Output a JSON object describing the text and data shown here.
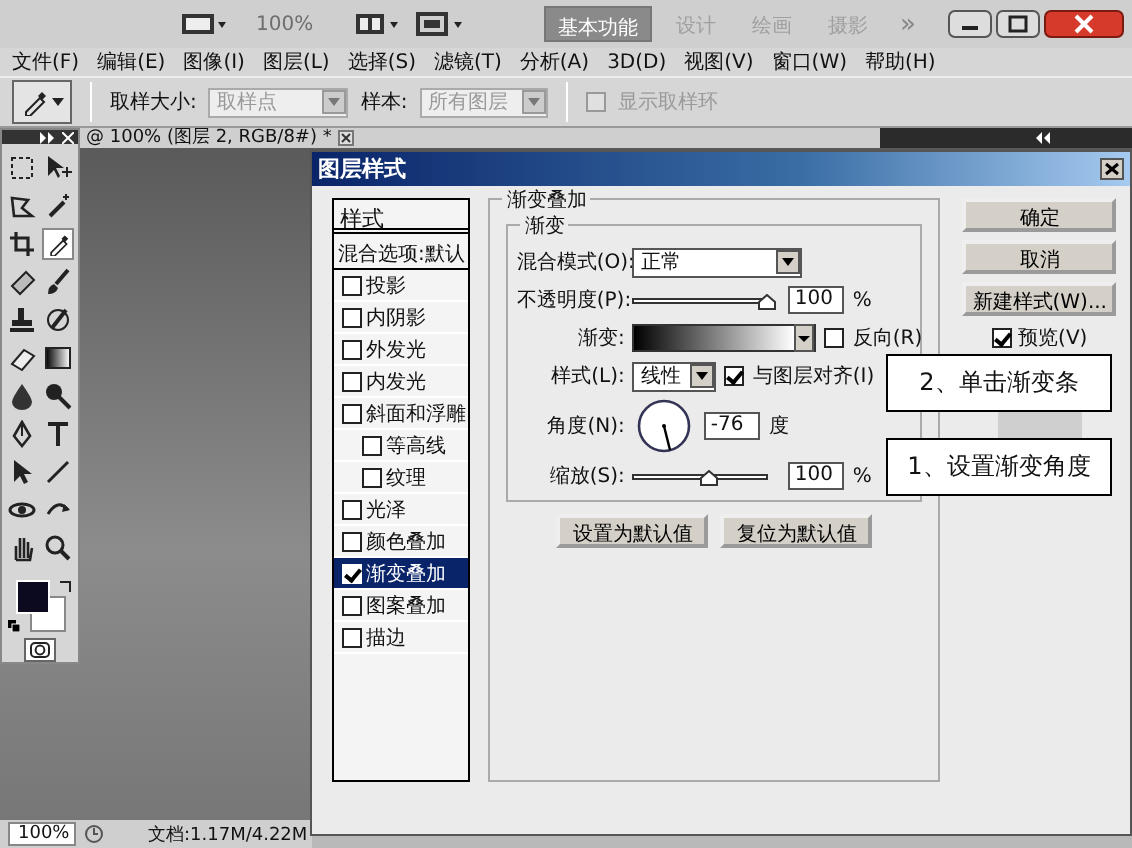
{
  "app_bar": {
    "zoom_value": "100%",
    "workspaces": [
      {
        "label": "基本功能",
        "selected": true
      },
      {
        "label": "设计",
        "selected": false
      },
      {
        "label": "绘画",
        "selected": false
      },
      {
        "label": "摄影",
        "selected": false
      }
    ],
    "more": "»"
  },
  "menu": [
    "文件(F)",
    "编辑(E)",
    "图像(I)",
    "图层(L)",
    "选择(S)",
    "滤镜(T)",
    "分析(A)",
    "3D(D)",
    "视图(V)",
    "窗口(W)",
    "帮助(H)"
  ],
  "options_bar": {
    "size_label": "取样大小:",
    "size_value": "取样点",
    "sample_label": "样本:",
    "sample_value": "所有图层",
    "ring_label": "显示取样环",
    "ring_checked": false,
    "ring_disabled": true
  },
  "document_tab": {
    "title": "@ 100% (图层 2, RGB/8#) *"
  },
  "status_bar": {
    "zoom": "100%",
    "doc_size": "文档:1.17M/4.22M"
  },
  "dialog": {
    "title": "图层样式",
    "styles_header": "样式",
    "blend_options": "混合选项:默认",
    "styles": [
      {
        "label": "投影",
        "checked": false,
        "selected": false
      },
      {
        "label": "内阴影",
        "checked": false,
        "selected": false
      },
      {
        "label": "外发光",
        "checked": false,
        "selected": false
      },
      {
        "label": "内发光",
        "checked": false,
        "selected": false
      },
      {
        "label": "斜面和浮雕",
        "checked": false,
        "selected": false,
        "children": [
          {
            "label": "等高线",
            "checked": false,
            "selected": false
          },
          {
            "label": "纹理",
            "checked": false,
            "selected": false
          }
        ]
      },
      {
        "label": "光泽",
        "checked": false,
        "selected": false
      },
      {
        "label": "颜色叠加",
        "checked": false,
        "selected": false
      },
      {
        "label": "渐变叠加",
        "checked": true,
        "selected": true
      },
      {
        "label": "图案叠加",
        "checked": false,
        "selected": false
      },
      {
        "label": "描边",
        "checked": false,
        "selected": false
      }
    ],
    "section_title": "渐变叠加",
    "group_title": "渐变",
    "blend_mode": {
      "label": "混合模式(O):",
      "value": "正常"
    },
    "opacity": {
      "label": "不透明度(P):",
      "level": 1,
      "value": "100",
      "unit": "%"
    },
    "gradient": {
      "label": "渐变:",
      "reverse_label": "反向(R)",
      "reverse_checked": false
    },
    "style": {
      "label": "样式(L):",
      "value": "线性",
      "align_label": "与图层对齐(I)",
      "align_checked": true
    },
    "angle": {
      "label": "角度(N):",
      "value": "-76",
      "unit": "度"
    },
    "scale": {
      "label": "缩放(S):",
      "level": 0.55,
      "value": "100",
      "unit": "%"
    },
    "default_buttons": [
      "设置为默认值",
      "复位为默认值"
    ],
    "buttons": [
      "确定",
      "取消",
      "新建样式(W)..."
    ],
    "preview": {
      "label": "预览(V)",
      "checked": true
    }
  },
  "callouts": [
    "2、单击渐变条",
    "1、设置渐变角度"
  ]
}
